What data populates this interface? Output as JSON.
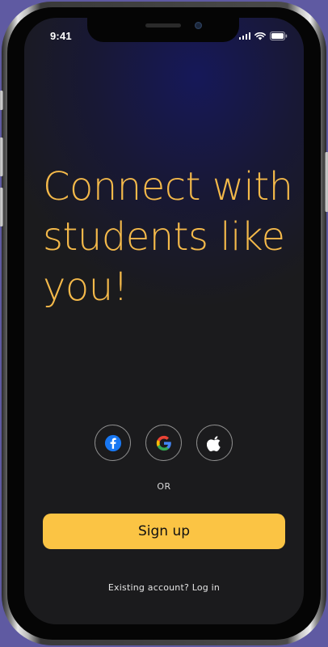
{
  "status_bar": {
    "time": "9:41",
    "icons": [
      "signal-icon",
      "wifi-icon",
      "battery-icon"
    ]
  },
  "hero": {
    "headline": "Connect with students like you!"
  },
  "social_login": {
    "buttons": [
      {
        "icon": "facebook-icon"
      },
      {
        "icon": "google-icon"
      },
      {
        "icon": "apple-icon"
      }
    ],
    "divider_label": "OR"
  },
  "actions": {
    "signup_label": "Sign up",
    "existing_account_text": "Existing account?",
    "login_label": "Log in"
  },
  "colors": {
    "accent": "#fbc444",
    "headline": "#f4b94a",
    "background": "#1b1b1d",
    "frame_background": "#5f5aa2"
  }
}
